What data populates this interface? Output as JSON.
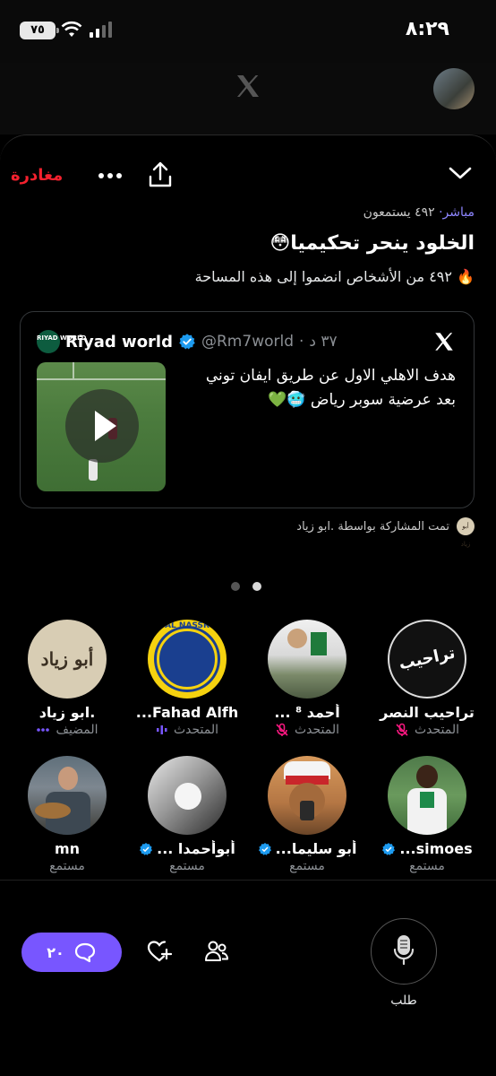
{
  "status_bar": {
    "time": "٨:٢٩",
    "battery": "٧٥"
  },
  "header": {
    "leave_label": "مغادرة",
    "live_label": "مباشر",
    "listener_count": "٤٩٢ يستمعون",
    "title": "الخلود ينحر تحكيميا😳",
    "joined_text": "٤٩٢ من الأشخاص انضموا إلى هذه المساحة",
    "joined_icon": "🔥"
  },
  "tweet": {
    "author_name": "Riyad world",
    "handle": "@Rm7world",
    "time": "٣٧ د",
    "avatar_text": "RIYAD WORLD",
    "text": "هدف الاهلي الاول عن طريق ايفان توني بعد عرضية سوبر رياض 🥶💚"
  },
  "shared_by": {
    "text": "تمت المشاركة بواسطة .ابو زياد",
    "avatar_text": "أبو زياد"
  },
  "participants": [
    {
      "name": "تراحيب النصر",
      "role": "المتحدث",
      "avatar_text": "تراحيب"
    },
    {
      "name": "أحمد ⁸ ...",
      "role": "المتحدث"
    },
    {
      "name": "Fahad  Alfh...",
      "role": "المتحدث",
      "avatar_text": "AL NASSR"
    },
    {
      "name": ".ابو زياد",
      "role": "المضيف",
      "avatar_text": "أبو زياد"
    },
    {
      "name": "simoes...",
      "role": "مستمع"
    },
    {
      "name": "أبو سليما...",
      "role": "مستمع"
    },
    {
      "name": "أبوأحمدا ...",
      "role": "مستمع"
    },
    {
      "name": "mn",
      "role": "مستمع"
    }
  ],
  "footer": {
    "reactions_count": "٢٠",
    "request_label": "طلب"
  },
  "colors": {
    "accent": "#7856ff",
    "leave": "#f4212e",
    "verified": "#1d9bf0",
    "mute": "#f91880"
  }
}
